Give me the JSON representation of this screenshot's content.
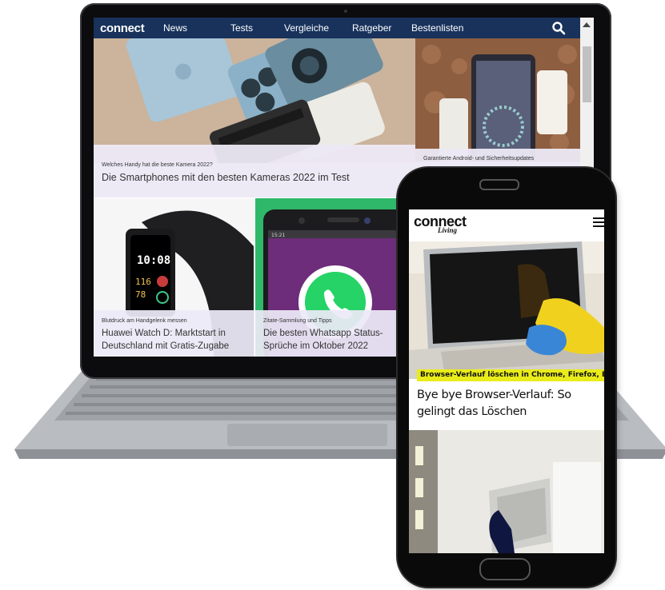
{
  "desktop": {
    "nav": {
      "logo": "connect",
      "items": [
        "News",
        "Tests",
        "Vergleiche",
        "Ratgeber",
        "Bestenlisten"
      ]
    },
    "hero": {
      "kicker": "Welches Handy hat die beste Kamera 2022?",
      "headline": "Die Smartphones mit den besten Kameras 2022 im Test"
    },
    "side": {
      "kicker": "Garantierte Android- und Sicherheitsupdates"
    },
    "tiles": [
      {
        "kicker": "Blutdruck am Handgelenk messen",
        "headline_line1": "Huawei Watch D: Marktstart in",
        "headline_line2": "Deutschland mit Gratis-Zugabe",
        "watch_time": "10:08",
        "watch_val1": "116",
        "watch_val2": "78"
      },
      {
        "kicker": "Zitate-Sammlung und Tipps",
        "headline_line1": "Die besten Whatsapp Status-",
        "headline_line2": "Sprüche im Oktober 2022",
        "phone_time": "15:21"
      }
    ]
  },
  "mobile": {
    "logo": "connect",
    "logo_sub": "Living",
    "kicker": "Browser-Verlauf löschen in Chrome, Firefox, Edge...",
    "title": "Bye bye Browser-Verlauf: So gelingt das Löschen"
  },
  "colors": {
    "nav_bg": "#18325c",
    "caption_bg": "#ece9f6",
    "whatsapp_green": "#2fb86a",
    "highlight_yellow": "#e9ec1a"
  }
}
